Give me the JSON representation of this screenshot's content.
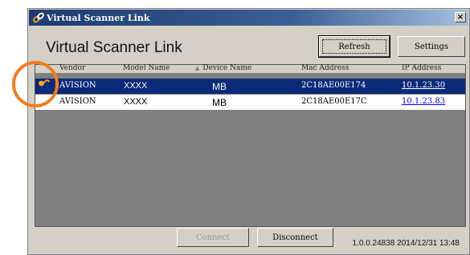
{
  "window": {
    "title": "Virtual Scanner Link",
    "close_label": "×"
  },
  "app": {
    "heading": "Virtual Scanner Link"
  },
  "toolbar": {
    "refresh_label": "Refresh",
    "settings_label": "Settings"
  },
  "table": {
    "columns": [
      "Vendor",
      "Model Name",
      "Device Name",
      "Mac Address",
      "IP Address"
    ],
    "sort_indicator": "▲",
    "rows": [
      {
        "vendor": "AVISION",
        "model": "XXXX",
        "device": "MB",
        "mac": "2C18AE00E174",
        "ip": "10.1.23.30",
        "selected": true
      },
      {
        "vendor": "AVISION",
        "model": "XXXX",
        "device": "MB",
        "mac": "2C18AE00E17C",
        "ip": "10.1.23.83",
        "selected": false
      }
    ]
  },
  "actions": {
    "connect_label": "Connect",
    "disconnect_label": "Disconnect"
  },
  "status": {
    "text": "1.0.0.24838 2014/12/31 13:48"
  },
  "icons": {
    "title_icon": "link-icon",
    "row_marker": "connection-icon",
    "highlight": "orange-highlight-circle"
  },
  "colors": {
    "highlight": "#f07e1e",
    "selected_row": "#0c2a78",
    "link": "#0000ee"
  }
}
